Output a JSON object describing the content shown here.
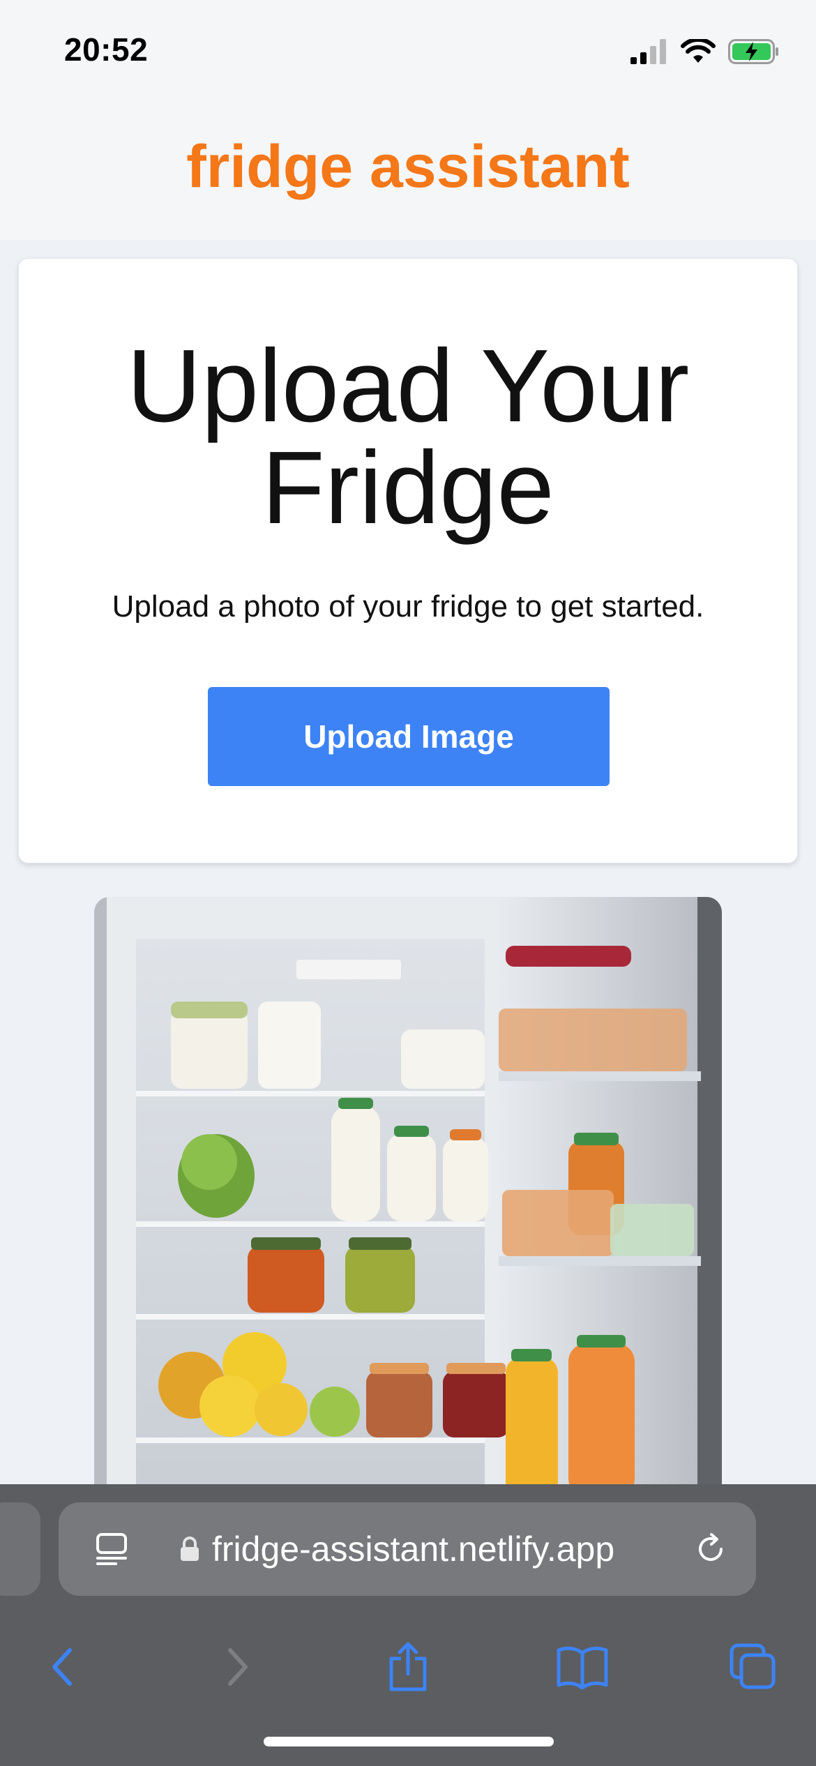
{
  "status_bar": {
    "time": "20:52",
    "icons": [
      "cellular-signal-icon",
      "wifi-icon",
      "battery-charging-icon"
    ]
  },
  "header": {
    "title": "fridge assistant",
    "title_color": "#f47718"
  },
  "upload_card": {
    "heading": "Upload Your Fridge",
    "subtitle": "Upload a photo of your fridge to get started.",
    "button_label": "Upload Image",
    "button_color": "#3d83f6"
  },
  "image": {
    "icon": "fridge-photo"
  },
  "browser": {
    "url": "fridge-assistant.netlify.app",
    "icons": [
      "page-menu-icon",
      "lock-icon",
      "reload-icon",
      "back-icon",
      "forward-icon",
      "share-icon",
      "bookmarks-icon",
      "tabs-icon"
    ]
  }
}
